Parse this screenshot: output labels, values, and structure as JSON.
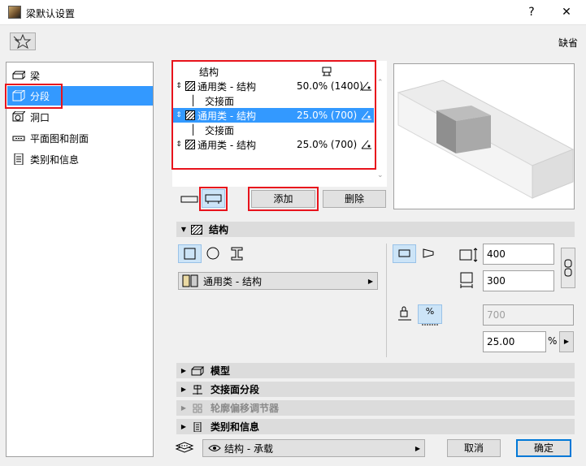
{
  "window": {
    "title": "梁默认设置",
    "help": "?",
    "close": "✕"
  },
  "header": {
    "default_label": "缺省"
  },
  "nav": {
    "items": [
      {
        "label": "梁"
      },
      {
        "label": "分段"
      },
      {
        "label": "洞口"
      },
      {
        "label": "平面图和剖面"
      },
      {
        "label": "类别和信息"
      }
    ],
    "selected_index": 1
  },
  "segment_table": {
    "header_label": "结构",
    "rows": [
      {
        "kind": "segment",
        "material": "通用类 - 结构",
        "value": "50.0% (1400)"
      },
      {
        "kind": "junction",
        "label": "交接面"
      },
      {
        "kind": "segment",
        "material": "通用类 - 结构",
        "value": "25.0% (700)",
        "selected": true
      },
      {
        "kind": "junction",
        "label": "交接面"
      },
      {
        "kind": "segment",
        "material": "通用类 - 结构",
        "value": "25.0% (700)"
      }
    ]
  },
  "segment_actions": {
    "add_label": "添加",
    "delete_label": "删除"
  },
  "sections": {
    "structure": "结构",
    "model": "模型",
    "junction_segment": "交接面分段",
    "profile_modifier": "轮廓偏移调节器",
    "classification": "类别和信息"
  },
  "structure_panel": {
    "building_material": "通用类 - 结构",
    "width": "400",
    "height": "300",
    "length": "700",
    "length_percent": "25.00",
    "percent_unit": "%"
  },
  "footer": {
    "layer": "结构 - 承载",
    "cancel_label": "取消",
    "ok_label": "确定"
  },
  "colors": {
    "selection": "#3399ff",
    "highlight_box": "#e8131c",
    "toggle_on": "#cce4f7"
  }
}
